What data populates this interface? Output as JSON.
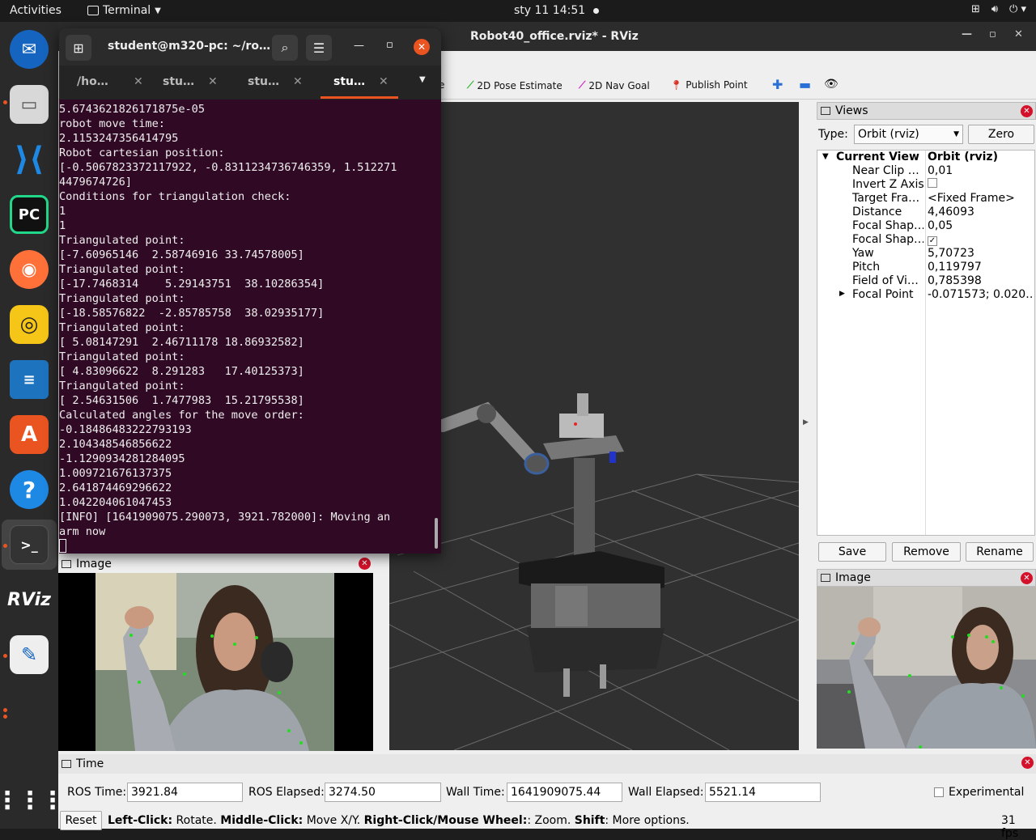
{
  "topbar": {
    "activities": "Activities",
    "app_name": "Terminal",
    "clock": "sty 11  14:51"
  },
  "dock": {
    "apps": [
      "Thunderbird",
      "Files",
      "Visual Studio Code",
      "PyCharm",
      "Firefox",
      "Rhythmbox",
      "LibreOffice Writer",
      "Ubuntu Software",
      "Help",
      "Terminal",
      "RViz",
      "Text Editor",
      "Show Applications"
    ]
  },
  "rviz": {
    "title": "Robot40_office.rviz* - RViz",
    "toolbar": {
      "partial_label": "e",
      "pose_estimate": "2D Pose Estimate",
      "nav_goal": "2D Nav Goal",
      "publish_point": "Publish Point"
    },
    "views": {
      "title": "Views",
      "type_label": "Type:",
      "type_value": "Orbit (rviz)",
      "zero_button": "Zero",
      "current_view_key": "Current View",
      "current_view_value": "Orbit (rviz)",
      "props": [
        {
          "key": "Near Clip …",
          "value": "0,01"
        },
        {
          "key": "Invert Z Axis",
          "value": ""
        },
        {
          "key": "Target Fra…",
          "value": "<Fixed Frame>"
        },
        {
          "key": "Distance",
          "value": "4,46093"
        },
        {
          "key": "Focal Shap…",
          "value": "0,05"
        },
        {
          "key": "Focal Shap…",
          "value": ""
        },
        {
          "key": "Yaw",
          "value": "5,70723"
        },
        {
          "key": "Pitch",
          "value": "0,119797"
        },
        {
          "key": "Field of Vi…",
          "value": "0,785398"
        },
        {
          "key": "Focal Point",
          "value": "-0.071573; 0.020…"
        }
      ],
      "invert_z_checked": false,
      "focal_shape_fixed_checked": true,
      "save_button": "Save",
      "remove_button": "Remove",
      "rename_button": "Rename"
    },
    "image_right": {
      "title": "Image"
    },
    "image_left": {
      "title": "Image"
    },
    "time": {
      "title": "Time",
      "ros_time_label": "ROS Time:",
      "ros_time_value": "3921.84",
      "ros_elapsed_label": "ROS Elapsed:",
      "ros_elapsed_value": "3274.50",
      "wall_time_label": "Wall Time:",
      "wall_time_value": "1641909075.44",
      "wall_elapsed_label": "Wall Elapsed:",
      "wall_elapsed_value": "5521.14",
      "experimental_label": "Experimental",
      "reset_button": "Reset",
      "hint_left_key": "Left-Click:",
      "hint_left_text": " Rotate. ",
      "hint_middle_key": "Middle-Click:",
      "hint_middle_text": " Move X/Y. ",
      "hint_right_key": "Right-Click/Mouse Wheel:",
      "hint_right_text": ": Zoom. ",
      "hint_shift_key": "Shift",
      "hint_shift_text": ": More options.",
      "fps": "31 fps"
    }
  },
  "terminal": {
    "title": "student@m320-pc: ~/ro…",
    "tabs": [
      "/ho…",
      "stu…",
      "stu…",
      "stu…"
    ],
    "active_tab": 3,
    "lines": [
      "5.6743621826171875e-05",
      "robot move time:",
      "2.1153247356414795",
      "Robot cartesian position:",
      "[-0.5067823372117922, -0.8311234736746359, 1.512271",
      "4479674726]",
      "Conditions for triangulation check:",
      "1",
      "1",
      "Triangulated point:",
      "[-7.60965146  2.58746916 33.74578005]",
      "Triangulated point:",
      "[-17.7468314    5.29143751  38.10286354]",
      "Triangulated point:",
      "[-18.58576822  -2.85785758  38.02935177]",
      "Triangulated point:",
      "[ 5.08147291  2.46711178 18.86932582]",
      "Triangulated point:",
      "[ 4.83096622  8.291283   17.40125373]",
      "Triangulated point:",
      "[ 2.54631506  1.7477983  15.21795538]",
      "Calculated angles for the move order:",
      "-0.18486483222793193",
      "2.104348546856622",
      "-1.1290934281284095",
      "1.009721676137375",
      "2.641874469296622",
      "1.042204061047453",
      "[INFO] [1641909075.290073, 3921.782000]: Moving an",
      "arm now"
    ]
  },
  "colors": {
    "terminal_bg": "#300a24",
    "close_red": "#d4112a",
    "ubuntu_orange": "#e95420",
    "viewport_bg": "#303030"
  }
}
